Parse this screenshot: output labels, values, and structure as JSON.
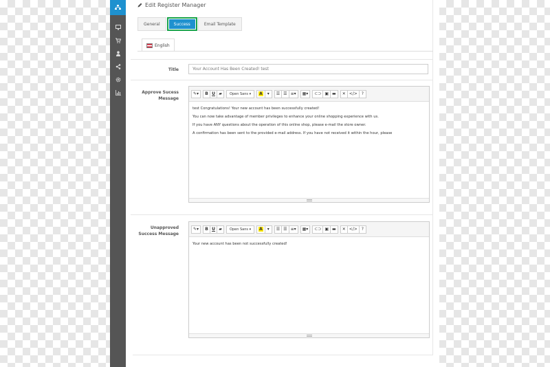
{
  "heading": "Edit Register Manager",
  "tabs": [
    {
      "label": "General",
      "active": false
    },
    {
      "label": "Success",
      "active": true
    },
    {
      "label": "Email Template",
      "active": false
    }
  ],
  "language": "English",
  "title_field": {
    "label": "Title",
    "value": "Your Account Has Been Created! test"
  },
  "approve": {
    "label_line1": "Approve Sucess",
    "label_line2": "Message",
    "lines": [
      "test Congratulations! Your new account has been successfully created!",
      "You can now take advantage of member privileges to enhance your online shopping experience with us.",
      "If you have ANY questions about the operation of this online shop, please e-mail the store owner.",
      "A confirmation has been sent to the provided e-mail address. If you have not received it within the hour, please"
    ]
  },
  "unapprove": {
    "label_line1": "Unapproved",
    "label_line2": "Success Message",
    "lines": [
      "Your new account has been not successfully created!"
    ]
  },
  "toolbar": {
    "bold": "B",
    "underline": "U",
    "font": "Open Sans",
    "highlight": "A",
    "code": "</>",
    "help": "?"
  },
  "colors": {
    "sidebar": "#555555",
    "accent": "#1e91cf",
    "active_border": "#19a34a",
    "highlight": "#ffe800"
  }
}
